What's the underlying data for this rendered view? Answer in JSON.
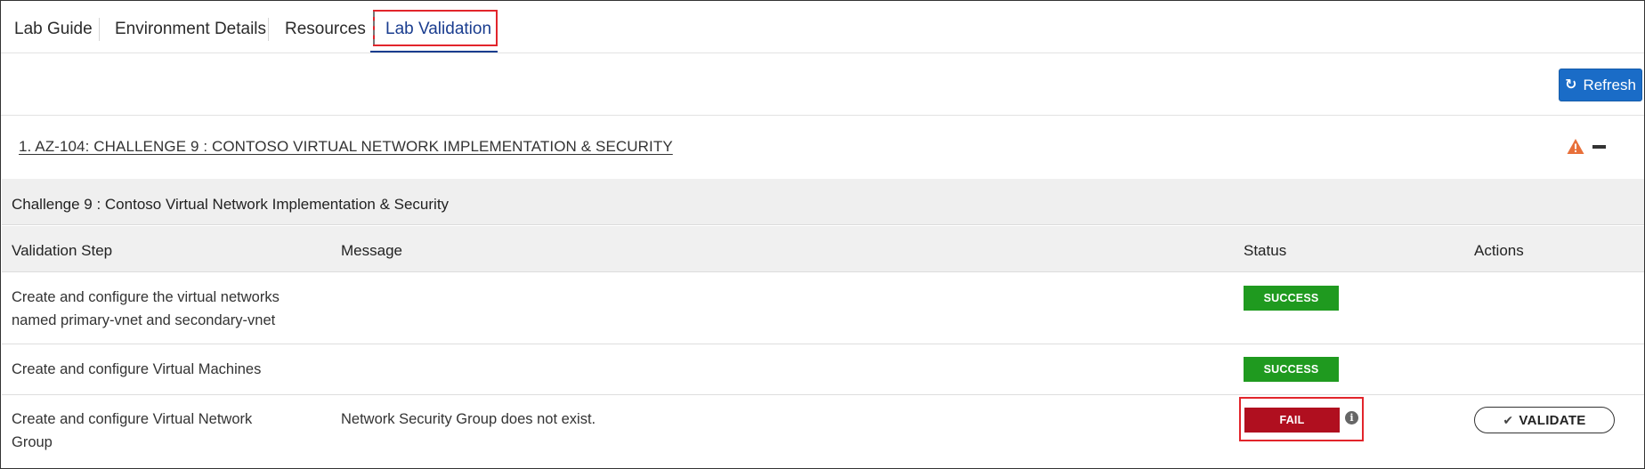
{
  "tabs": [
    {
      "label": "Lab Guide"
    },
    {
      "label": "Environment Details"
    },
    {
      "label": "Resources"
    },
    {
      "label": "Lab Validation"
    }
  ],
  "toolbar": {
    "refresh_label": "Refresh",
    "refresh_icon": "refresh-icon"
  },
  "section": {
    "title": "1. AZ-104: CHALLENGE 9 : CONTOSO VIRTUAL NETWORK IMPLEMENTATION & SECURITY",
    "status_icon": "warning-icon",
    "warning_color": "#e8703a"
  },
  "challenge": {
    "heading": "Challenge 9 : Contoso Virtual Network Implementation & Security"
  },
  "table": {
    "headers": [
      "Validation Step",
      "Message",
      "Status",
      "Actions"
    ],
    "rows": [
      {
        "step": "Create and configure the virtual networks named primary-vnet and secondary-vnet",
        "message": "",
        "status": "SUCCESS"
      },
      {
        "step": "Create and configure Virtual Machines",
        "message": "",
        "status": "SUCCESS"
      },
      {
        "step": "Create and configure Virtual Network Group",
        "message": "Network Security Group does not exist.",
        "status": "FAIL",
        "action": "VALIDATE"
      }
    ]
  },
  "colors": {
    "accent": "#1a6cc7",
    "success": "#1f9a1f",
    "fail": "#b00f1f",
    "highlight": "#e2252b"
  }
}
